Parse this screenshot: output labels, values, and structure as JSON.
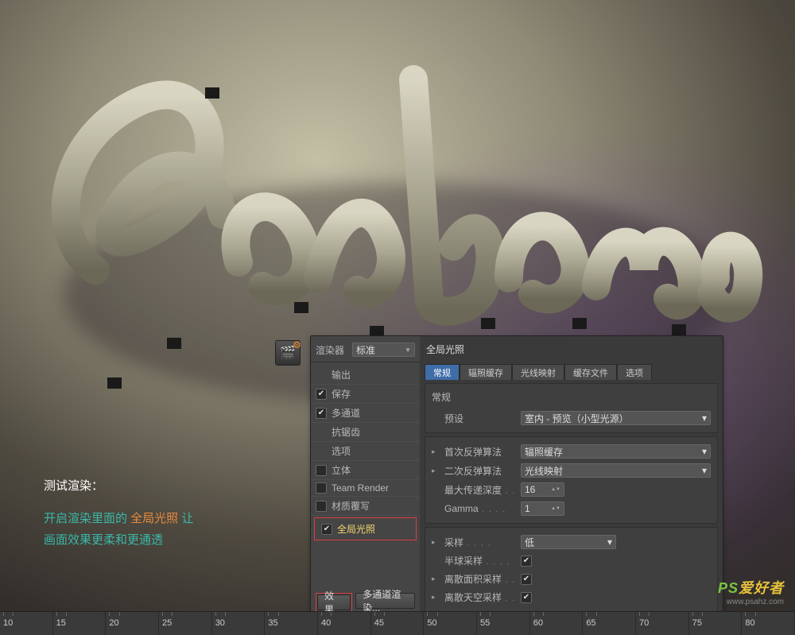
{
  "annotation": {
    "title": "测试渲染：",
    "body_part1": "开启渲染里面的 ",
    "highlight": "全局光照",
    "body_part2": " 让",
    "body_part3": "画面效果更柔和更通透"
  },
  "panel": {
    "renderer_label": "渲染器",
    "renderer_value": "标准",
    "options": [
      {
        "key": "output",
        "label": "输出",
        "checked": null
      },
      {
        "key": "save",
        "label": "保存",
        "checked": true
      },
      {
        "key": "multipass",
        "label": "多通道",
        "checked": true
      },
      {
        "key": "aa",
        "label": "抗锯齿",
        "checked": null
      },
      {
        "key": "opts",
        "label": "选项",
        "checked": null
      },
      {
        "key": "stereo",
        "label": "立体",
        "checked": false
      },
      {
        "key": "team",
        "label": "Team Render",
        "checked": false
      },
      {
        "key": "mat",
        "label": "材质覆写",
        "checked": false
      },
      {
        "key": "gi",
        "label": "全局光照",
        "checked": true,
        "highlight": true
      }
    ],
    "effects_btn": "效果...",
    "multipass_btn": "多通道渲染..."
  },
  "gi": {
    "title": "全局光照",
    "tabs": [
      "常规",
      "辐照缓存",
      "光线映射",
      "缓存文件",
      "选项"
    ],
    "active_tab": 0,
    "general_title": "常规",
    "preset_label": "预设",
    "preset_value": "室内 - 预览（小型光源）",
    "primary_label": "首次反弹算法",
    "primary_value": "辐照缓存",
    "secondary_label": "二次反弹算法",
    "secondary_value": "光线映射",
    "maxdepth_label": "最大传递深度",
    "maxdepth_value": "16",
    "gamma_label": "Gamma",
    "gamma_value": "1",
    "samples_label": "采样",
    "samples_value": "低",
    "hemi_label": "半球采样",
    "hemi_checked": true,
    "area_label": "离散面积采样",
    "area_checked": true,
    "sky_label": "离散天空采样",
    "sky_checked": true
  },
  "timeline": {
    "ticks": [
      "10",
      "15",
      "20",
      "25",
      "30",
      "35",
      "40",
      "45",
      "50",
      "55",
      "60",
      "65",
      "70",
      "75",
      "80"
    ]
  },
  "watermark": {
    "text1": "PS",
    "text2": "爱好者",
    "sub": "www.psahz.com"
  }
}
